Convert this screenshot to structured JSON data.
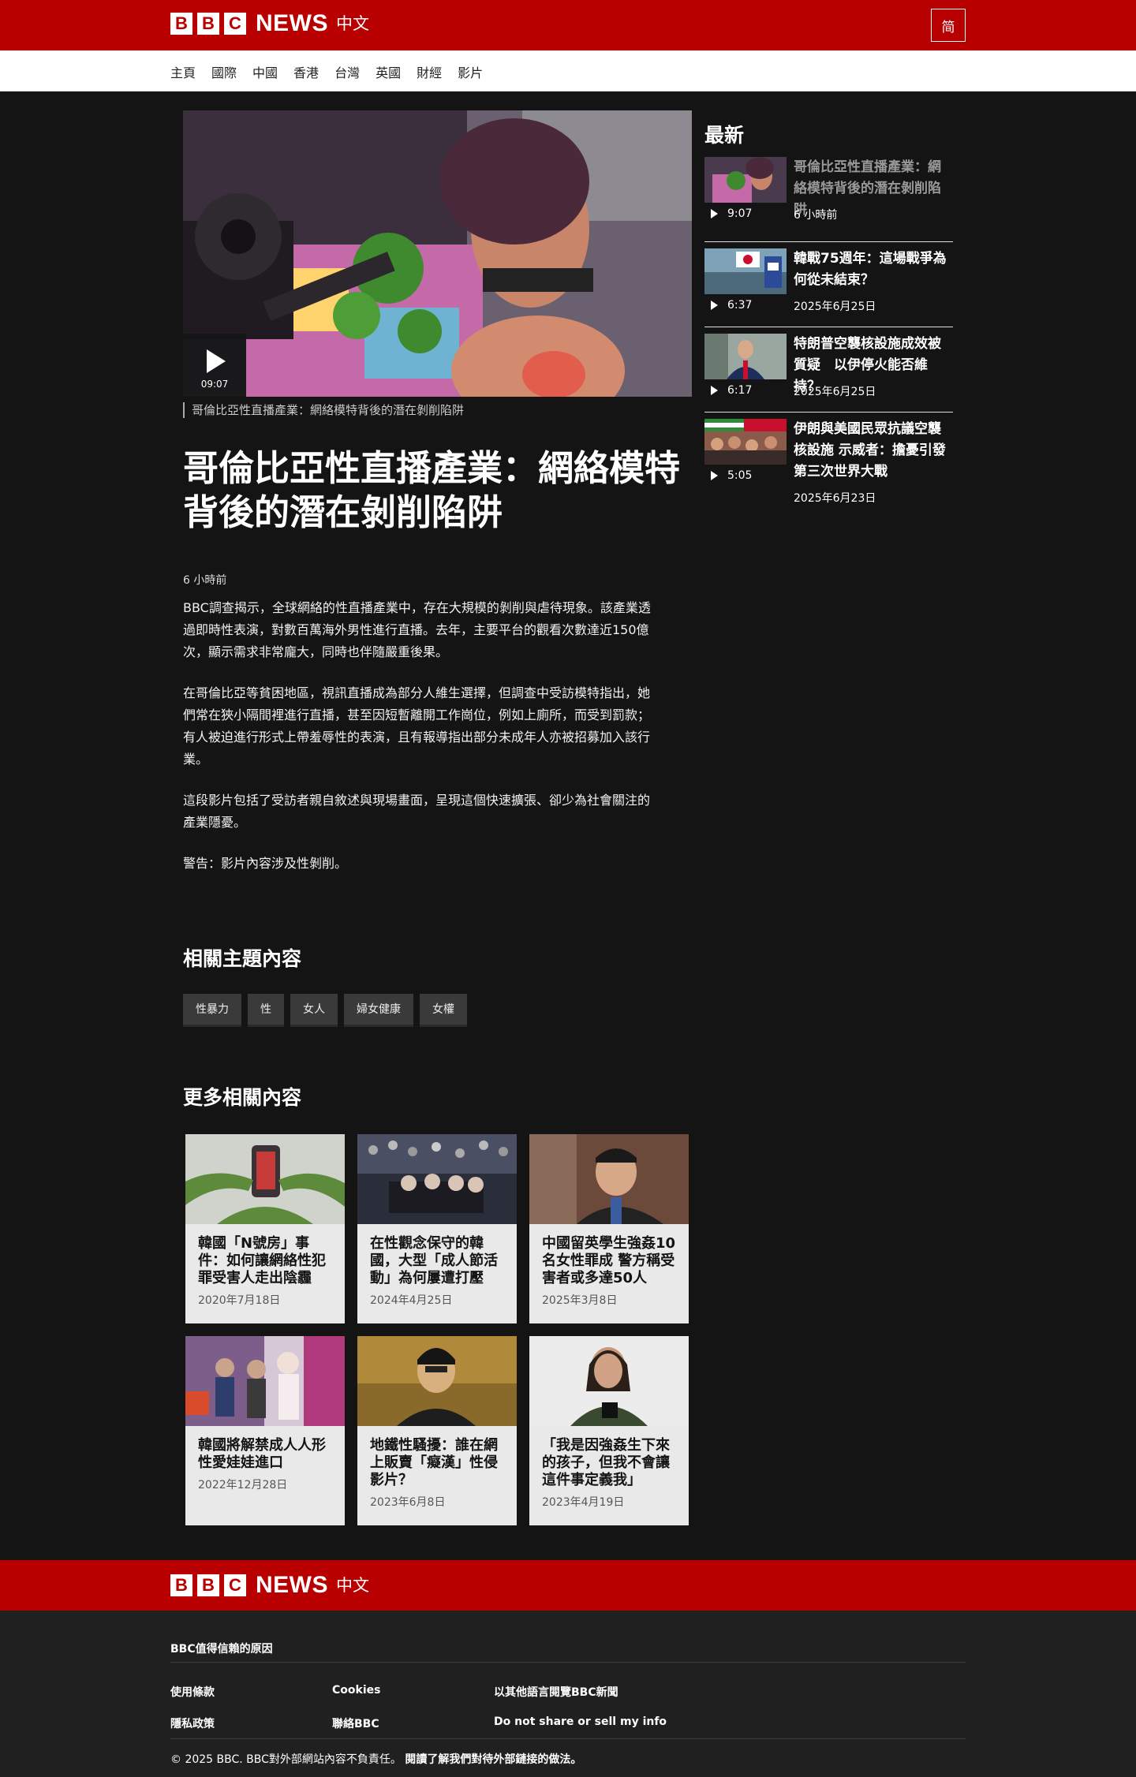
{
  "header": {
    "logo_blocks": [
      "B",
      "B",
      "C"
    ],
    "logo_news": "NEWS",
    "logo_zh": "中文",
    "script_toggle": "简"
  },
  "nav": {
    "items": [
      "主頁",
      "國際",
      "中國",
      "香港",
      "台灣",
      "英國",
      "財經",
      "影片"
    ]
  },
  "video": {
    "duration": "09:07",
    "caption": "哥倫比亞性直播產業：網絡模特背後的潛在剝削陷阱"
  },
  "article": {
    "headline": "哥倫比亞性直播產業：網絡模特背後的潛在剝削陷阱",
    "time": "6 小時前",
    "paragraphs": [
      "BBC調查揭示，全球網絡的性直播產業中，存在大規模的剝削與虐待現象。該產業透過即時性表演，對數百萬海外男性進行直播。去年，主要平台的觀看次數達近150億次，顯示需求非常龐大，同時也伴隨嚴重後果。",
      "在哥倫比亞等貧困地區，視訊直播成為部分人維生選擇，但調查中受訪模特指出，她們常在狹小隔間裡進行直播，甚至因短暫離開工作崗位，例如上廁所，而受到罰款；有人被迫進行形式上帶羞辱性的表演，且有報導指出部分未成年人亦被招募加入該行業。",
      "這段影片包括了受訪者親自敘述與現場畫面，呈現這個快速擴張、卻少為社會關注的產業隱憂。",
      "警告：影片內容涉及性剝削。"
    ]
  },
  "related_topics": {
    "title": "相關主題內容",
    "tags": [
      "性暴力",
      "性",
      "女人",
      "婦女健康",
      "女權"
    ]
  },
  "more": {
    "title": "更多相關內容",
    "cards": [
      {
        "title": "韓國「N號房」事件：如何讓網絡性犯罪受害人走出陰霾",
        "date": "2020年7月18日"
      },
      {
        "title": "在性觀念保守的韓國，大型「成人節活動」為何屢遭打壓",
        "date": "2024年4月25日"
      },
      {
        "title": "中國留英學生強姦10名女性罪成 警方稱受害者或多達50人",
        "date": "2025年3月8日"
      },
      {
        "title": "韓國將解禁成人人形性愛娃娃進口",
        "date": "2022年12月28日"
      },
      {
        "title": "地鐵性騷擾：誰在網上販賣「癡漢」性侵影片？",
        "date": "2023年6月8日"
      },
      {
        "title": "「我是因強姦生下來的孩子，但我不會讓這件事定義我」",
        "date": "2023年4月19日"
      }
    ]
  },
  "sidebar": {
    "title": "最新",
    "items": [
      {
        "title": "哥倫比亞性直播產業：網絡模特背後的潛在剝削陷阱",
        "duration": "9:07",
        "date": "6 小時前"
      },
      {
        "title": "韓戰75週年：這場戰爭為何從未結束？",
        "duration": "6:37",
        "date": "2025年6月25日"
      },
      {
        "title": "特朗普空襲核設施成效被質疑　以伊停火能否維持？",
        "duration": "6:17",
        "date": "2025年6月25日"
      },
      {
        "title": "伊朗與美國民眾抗議空襲核設施 示威者：擔憂引發第三次世界大戰",
        "duration": "5:05",
        "date": "2025年6月23日"
      }
    ]
  },
  "footer": {
    "trust": "BBC值得信賴的原因",
    "links": {
      "terms": "使用條款",
      "privacy": "隱私政策",
      "cookies": "Cookies",
      "contact": "聯絡BBC",
      "other_lang": "以其他語言閱覽BBC新聞",
      "do_not_share": "Do not share or sell my info"
    },
    "copyright": "© 2025 BBC. BBC對外部網站內容不負責任。",
    "external_link": "閱讀了解我們對待外部鏈接的做法。"
  },
  "colors": {
    "brand_red": "#b80000",
    "page_bg": "#141414",
    "card_bg": "#e9e9e9",
    "footer_bg": "#202020"
  }
}
